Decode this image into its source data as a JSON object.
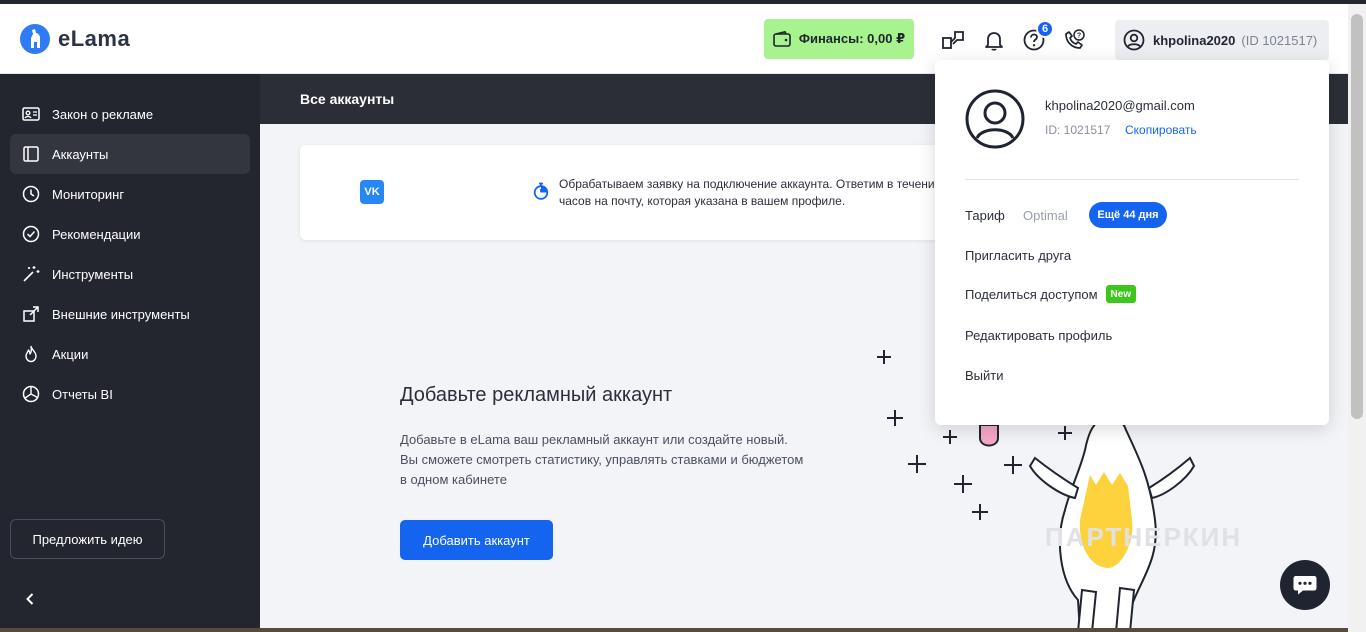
{
  "header": {
    "logo_text": "eLama",
    "finance_label": "Финансы: 0,00 ₽",
    "help_badge": "6",
    "user_name": "khpolina2020",
    "user_id": "(ID 1021517)"
  },
  "sidebar": {
    "items": [
      {
        "label": "Закон о рекламе",
        "icon": "id-card-icon"
      },
      {
        "label": "Аккаунты",
        "icon": "accounts-icon"
      },
      {
        "label": "Мониторинг",
        "icon": "clock-icon"
      },
      {
        "label": "Рекомендации",
        "icon": "check-circle-icon"
      },
      {
        "label": "Инструменты",
        "icon": "magic-wand-icon"
      },
      {
        "label": "Внешние инструменты",
        "icon": "external-link-icon"
      },
      {
        "label": "Акции",
        "icon": "flame-icon"
      },
      {
        "label": "Отчеты BI",
        "icon": "pie-chart-icon"
      }
    ],
    "active_index": 1,
    "idea_button": "Предложить идею"
  },
  "main": {
    "subheader_title": "Все аккаунты",
    "notice_vk": "VK",
    "notice_line1": "Обрабатываем заявку на подключение аккаунта. Ответим в течени",
    "notice_line2": "часов на почту, которая указана в вашем профиле.",
    "empty_title": "Добавьте рекламный аккаунт",
    "empty_desc_line1": "Добавьте в eLama ваш рекламный аккаунт или создайте новый.",
    "empty_desc_line2": "Вы сможете смотреть статистику, управлять ставками и бюджетом",
    "empty_desc_line3": "в одном кабинете",
    "add_button": "Добавить аккаунт",
    "watermark": "ПАРТНЕРКИН"
  },
  "dropdown": {
    "email": "khpolina2020@gmail.com",
    "id_label": "ID: 1021517",
    "copy_label": "Скопировать",
    "tariff_label": "Тариф",
    "tariff_value": "Optimal",
    "trial_badge": "Ещё 44 дня",
    "invite_label": "Пригласить друга",
    "share_label": "Поделиться доступом",
    "new_badge": "New",
    "edit_label": "Редактировать профиль",
    "logout_label": "Выйти"
  },
  "colors": {
    "accent": "#1464f0",
    "finance_bg": "#a7f38d",
    "sidebar_bg": "#23262f",
    "new_badge": "#3fc61c"
  }
}
